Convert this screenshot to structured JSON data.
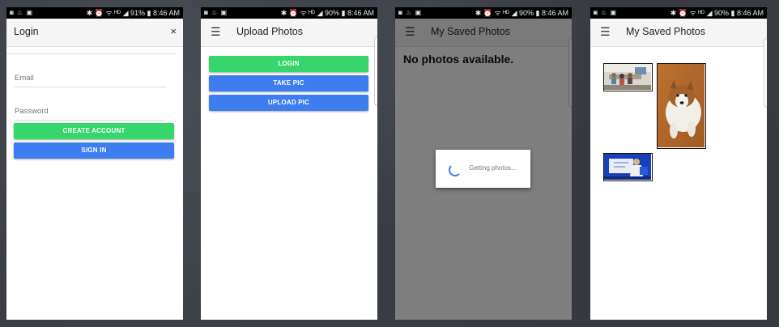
{
  "screens": [
    {
      "status": {
        "left_icons": "◙ ♨ ▣",
        "right": "✱ ⏰ ᯤ ᴴᴰ ◢ 91% ▮ 8:46 AM"
      },
      "appbar": {
        "title": "Login",
        "close_glyph": "×"
      },
      "fields": {
        "email_placeholder": "Email",
        "password_placeholder": "Password"
      },
      "buttons": {
        "create_account": "CREATE ACCOUNT",
        "sign_in": "SIGN IN"
      }
    },
    {
      "status": {
        "left_icons": "◙ ♨ ▣",
        "right": "✱ ⏰ ᯤ ᴴᴰ ◢ 90% ▮ 8:46 AM"
      },
      "appbar": {
        "title": "Upload Photos",
        "menu_glyph": "☰"
      },
      "buttons": {
        "login": "LOGIN",
        "take_pic": "TAKE PIC",
        "upload_pic": "UPLOAD PIC"
      }
    },
    {
      "status": {
        "left_icons": "◙ ♨ ▣",
        "right": "✱ ⏰ ᯤ ᴴᴰ ◢ 90% ▮ 8:46 AM"
      },
      "appbar": {
        "title": "My Saved Photos",
        "menu_glyph": "☰"
      },
      "empty_message": "No photos available.",
      "dialog": {
        "message": "Getting photos..."
      }
    },
    {
      "status": {
        "left_icons": "◙ ♨ ▣",
        "right": "✱ ⏰ ᯤ ᴴᴰ ◢ 90% ▮ 8:46 AM"
      },
      "appbar": {
        "title": "My Saved Photos",
        "menu_glyph": "☰"
      },
      "photos": [
        "classroom-photo",
        "dog-photo",
        "person-at-board-photo"
      ]
    }
  ],
  "colors": {
    "green_button": "#37d66c",
    "blue_button": "#3e7df0",
    "app_bar": "#f5f5f5",
    "status_bar": "#000000"
  }
}
